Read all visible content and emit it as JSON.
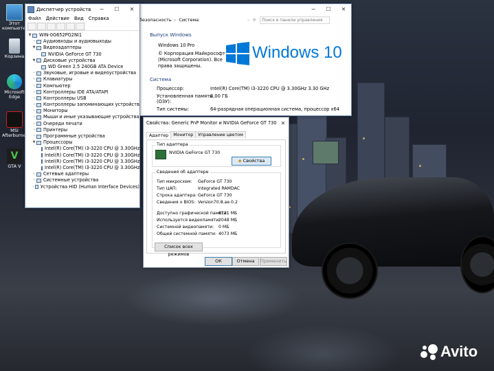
{
  "desktop_icons": [
    {
      "label": "Этот\nкомпьютер",
      "icon": "computer-icon"
    },
    {
      "label": "Корзина",
      "icon": "recycle-bin-icon"
    },
    {
      "label": "Microsoft Edge",
      "icon": "edge-icon"
    },
    {
      "label": "MSI Afterburner",
      "icon": "afterburner-icon"
    },
    {
      "label": "GTA V",
      "icon": "gta-icon"
    }
  ],
  "device_manager": {
    "title": "Диспетчер устройств",
    "menu": [
      "Файл",
      "Действие",
      "Вид",
      "Справка"
    ],
    "root": "WIN-0G652PG2NI1",
    "tree": [
      {
        "level": 1,
        "label": "Аудиовходы и аудиовыходы",
        "expanded": false
      },
      {
        "level": 1,
        "label": "Видеоадаптеры",
        "expanded": true
      },
      {
        "level": 2,
        "label": "NVIDIA GeForce GT 730"
      },
      {
        "level": 1,
        "label": "Дисковые устройства",
        "expanded": true
      },
      {
        "level": 2,
        "label": "WD Green 2.5 240GB ATA Device"
      },
      {
        "level": 1,
        "label": "Звуковые, игровые и видеоустройства",
        "expanded": false
      },
      {
        "level": 1,
        "label": "Клавиатуры",
        "expanded": false
      },
      {
        "level": 1,
        "label": "Компьютер",
        "expanded": false
      },
      {
        "level": 1,
        "label": "Контроллеры IDE ATA/ATAPI",
        "expanded": false
      },
      {
        "level": 1,
        "label": "Контроллеры USB",
        "expanded": false
      },
      {
        "level": 1,
        "label": "Контроллеры запоминающих устройств",
        "expanded": false
      },
      {
        "level": 1,
        "label": "Мониторы",
        "expanded": false
      },
      {
        "level": 1,
        "label": "Мыши и иные указывающие устройства",
        "expanded": false
      },
      {
        "level": 1,
        "label": "Очереди печати",
        "expanded": false
      },
      {
        "level": 1,
        "label": "Принтеры",
        "expanded": false
      },
      {
        "level": 1,
        "label": "Программные устройства",
        "expanded": false
      },
      {
        "level": 1,
        "label": "Процессоры",
        "expanded": true
      },
      {
        "level": 2,
        "label": "Intel(R) Core(TM) i3-3220 CPU @ 3.30GHz"
      },
      {
        "level": 2,
        "label": "Intel(R) Core(TM) i3-3220 CPU @ 3.30GHz"
      },
      {
        "level": 2,
        "label": "Intel(R) Core(TM) i3-3220 CPU @ 3.30GHz"
      },
      {
        "level": 2,
        "label": "Intel(R) Core(TM) i3-3220 CPU @ 3.30GHz"
      },
      {
        "level": 1,
        "label": "Сетевые адаптеры",
        "expanded": false
      },
      {
        "level": 1,
        "label": "Системные устройства",
        "expanded": false
      },
      {
        "level": 1,
        "label": "Устройства HID (Human Interface Devices)",
        "expanded": false
      }
    ]
  },
  "system": {
    "breadcrumb_1": "безопасность",
    "breadcrumb_2": "Система",
    "search_placeholder": "Поиск в панели управления",
    "edition_header": "Выпуск Windows",
    "edition": "Windows 10 Pro",
    "copyright_1": "© Корпорация Майкрософт",
    "copyright_2": "(Microsoft Corporation). Все",
    "copyright_3": "права защищены.",
    "logo_text": "Windows 10",
    "system_header": "Система",
    "rows": [
      {
        "label": "Процессор:",
        "value": "Intel(R) Core(TM) i3-3220 CPU @ 3.30GHz   3.30 GHz"
      },
      {
        "label": "Установленная память\n(ОЗУ):",
        "value": "8,00 ГБ"
      },
      {
        "label": "Тип системы:",
        "value": "64-разрядная операционная система, процессор x64"
      }
    ]
  },
  "props": {
    "title": "Свойства: Generic PnP Monitor и NVIDIA GeForce GT 730",
    "tabs": [
      "Адаптер",
      "Монитор",
      "Управление цветом"
    ],
    "adapter_type_header": "Тип адаптера",
    "adapter_name": "NVIDIA GeForce GT 730",
    "properties_button": "Свойства",
    "info_header": "Сведения об адаптере",
    "info": [
      {
        "label": "Тип микросхем:",
        "value": "GeForce GT 730"
      },
      {
        "label": "Тип ЦАП:",
        "value": "Integrated RAMDAC"
      },
      {
        "label": "Строка адаптера:",
        "value": "GeForce GT 730"
      },
      {
        "label": "Сведения о BIOS:",
        "value": "Version70.8.ae.0.2"
      }
    ],
    "memory": [
      {
        "label": "Доступно графической памяти:",
        "value": "6121 МБ"
      },
      {
        "label": "Используется видеопамяти:",
        "value": "2048 МБ"
      },
      {
        "label": "Системной видеопамяти:",
        "value": "0 МБ"
      },
      {
        "label": "Общей системной памяти:",
        "value": "4073 МБ"
      }
    ],
    "modes_button": "Список всех режимов",
    "ok": "ОК",
    "cancel": "Отмена",
    "apply": "Применить"
  },
  "watermark": "Avito",
  "colors": {
    "win_blue": "#0078d7",
    "section_title": "#1e3c78"
  }
}
